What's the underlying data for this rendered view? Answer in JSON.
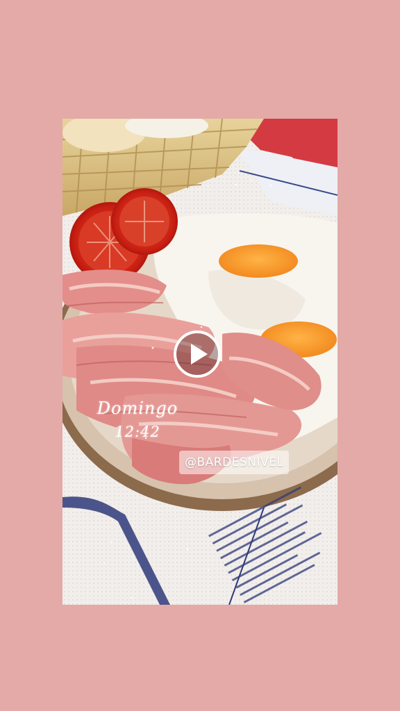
{
  "story": {
    "day": "Domingo",
    "time": "12:42",
    "mention": "@BARDESNIVEL"
  },
  "controls": {
    "play_icon": "play-icon"
  },
  "colors": {
    "background": "#e3aaa8",
    "overlay_text": "#ffffff"
  }
}
